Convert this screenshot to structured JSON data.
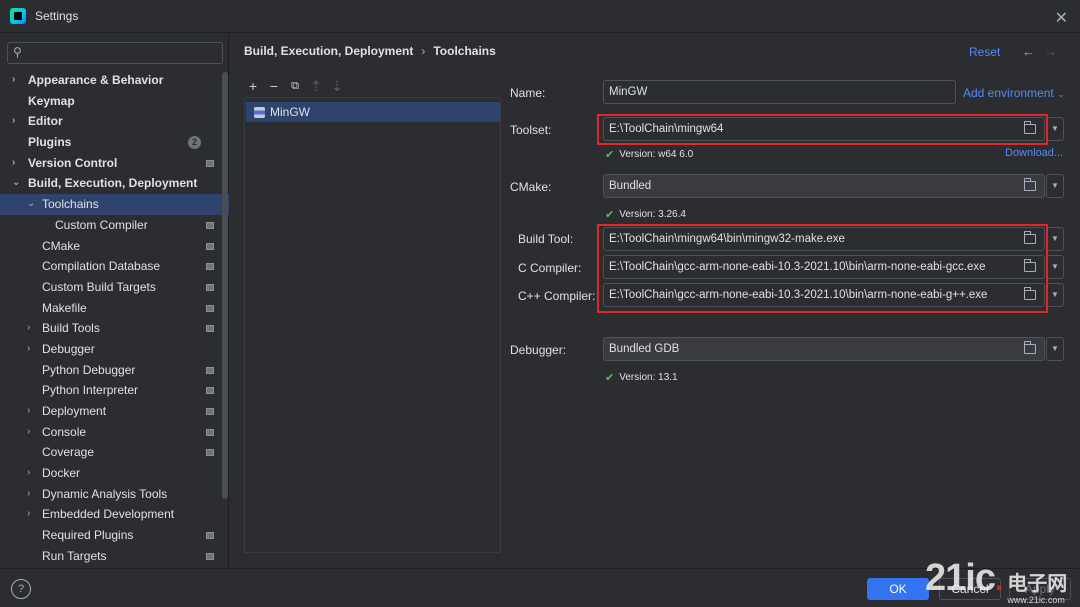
{
  "window": {
    "title": "Settings"
  },
  "search": {
    "placeholder": ""
  },
  "sidebar": {
    "items": [
      {
        "label": "Appearance & Behavior",
        "arrow": "›",
        "level": 0,
        "bold": true
      },
      {
        "label": "Keymap",
        "arrow": "",
        "level": 0,
        "bold": true
      },
      {
        "label": "Editor",
        "arrow": "›",
        "level": 0,
        "bold": true
      },
      {
        "label": "Plugins",
        "arrow": "",
        "level": 0,
        "bold": true,
        "badge": "2"
      },
      {
        "label": "Version Control",
        "arrow": "›",
        "level": 0,
        "bold": true,
        "gicon": true
      },
      {
        "label": "Build, Execution, Deployment",
        "arrow": "⌄",
        "level": 0,
        "bold": true
      },
      {
        "label": "Toolchains",
        "arrow": "⌄",
        "level": 1,
        "selected": true
      },
      {
        "label": "Custom Compiler",
        "arrow": "",
        "level": 2,
        "gicon": true
      },
      {
        "label": "CMake",
        "arrow": "",
        "level": 1,
        "gicon": true
      },
      {
        "label": "Compilation Database",
        "arrow": "",
        "level": 1,
        "gicon": true
      },
      {
        "label": "Custom Build Targets",
        "arrow": "",
        "level": 1,
        "gicon": true
      },
      {
        "label": "Makefile",
        "arrow": "",
        "level": 1,
        "gicon": true
      },
      {
        "label": "Build Tools",
        "arrow": "›",
        "level": 1,
        "gicon": true
      },
      {
        "label": "Debugger",
        "arrow": "›",
        "level": 1
      },
      {
        "label": "Python Debugger",
        "arrow": "",
        "level": 1,
        "gicon": true
      },
      {
        "label": "Python Interpreter",
        "arrow": "",
        "level": 1,
        "gicon": true
      },
      {
        "label": "Deployment",
        "arrow": "›",
        "level": 1,
        "gicon": true
      },
      {
        "label": "Console",
        "arrow": "›",
        "level": 1,
        "gicon": true
      },
      {
        "label": "Coverage",
        "arrow": "",
        "level": 1,
        "gicon": true
      },
      {
        "label": "Docker",
        "arrow": "›",
        "level": 1
      },
      {
        "label": "Dynamic Analysis Tools",
        "arrow": "›",
        "level": 1
      },
      {
        "label": "Embedded Development",
        "arrow": "›",
        "level": 1
      },
      {
        "label": "Required Plugins",
        "arrow": "",
        "level": 1,
        "gicon": true
      },
      {
        "label": "Run Targets",
        "arrow": "",
        "level": 1,
        "gicon": true
      }
    ]
  },
  "header": {
    "breadcrumb": [
      "Build, Execution, Deployment",
      "Toolchains"
    ],
    "separator": "›",
    "reset_label": "Reset",
    "back_arrow": "←",
    "forward_arrow": "→"
  },
  "toolchain_list": {
    "toolbar": [
      "+",
      "−",
      "⧉",
      "⇡",
      "⇣"
    ],
    "items": [
      "MinGW"
    ]
  },
  "form": {
    "name_label": "Name:",
    "name_value": "MinGW",
    "add_environment": "Add environment",
    "add_environment_arrow": "⌄",
    "toolset_label": "Toolset:",
    "toolset_value": "E:\\ToolChain\\mingw64",
    "toolset_version": "Version: w64 6.0",
    "download_link": "Download...",
    "cmake_label": "CMake:",
    "cmake_value": "Bundled",
    "cmake_version": "Version: 3.26.4",
    "build_tool_label": "Build Tool:",
    "build_tool_value": "E:\\ToolChain\\mingw64\\bin\\mingw32-make.exe",
    "c_compiler_label": "C Compiler:",
    "c_compiler_value": "E:\\ToolChain\\gcc-arm-none-eabi-10.3-2021.10\\bin\\arm-none-eabi-gcc.exe",
    "cpp_compiler_label": "C++ Compiler:",
    "cpp_compiler_value": "E:\\ToolChain\\gcc-arm-none-eabi-10.3-2021.10\\bin\\arm-none-eabi-g++.exe",
    "debugger_label": "Debugger:",
    "debugger_value": "Bundled GDB",
    "debugger_version": "Version: 13.1"
  },
  "footer": {
    "help": "?",
    "ok_label": "OK",
    "cancel_label": "Cancel",
    "apply_label": "Apply"
  },
  "watermark": {
    "brand": "21ic",
    "cn": "电子网",
    "url": "www.21ic.com"
  },
  "colors": {
    "accent": "#3574f0",
    "selection": "#2e436e",
    "link": "#548af7",
    "highlight_box": "#e2262b",
    "check": "#5fb865"
  }
}
